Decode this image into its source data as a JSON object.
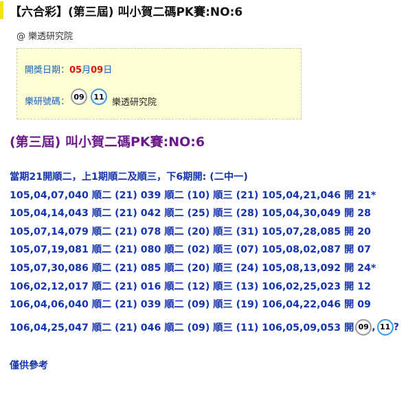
{
  "header": {
    "title": "【六合彩】(第三屆) 叫小賀二碼PK賽:NO:6",
    "source": "@ 樂透研究院"
  },
  "info_box": {
    "draw_date_label": "開獎日期：",
    "draw_month": "05",
    "month_unit": "月",
    "draw_day": "09",
    "day_unit": "日",
    "numbers_label": "樂研號碼：",
    "balls": [
      "09",
      "11"
    ],
    "source_name": "樂透研究院"
  },
  "main": {
    "heading": "(第三屆) 叫小賀二碼PK賽:NO:6",
    "intro": "當期21開順二，上1期順二及順三，下6期開: (二中一)",
    "records": [
      "105,04,07,040 順二 (21) 039 順二 (10) 順三 (21) 105,04,21,046 開 21*",
      "105,04,14,043 順二 (21) 042 順二 (25) 順三 (28) 105,04,30,049 開 28",
      "105,07,14,079 順二 (21) 078 順二 (20) 順三 (31) 105,07,28,085 開 20",
      "105,07,19,081 順二 (21) 080 順二 (02) 順三 (07) 105,08,02,087 開 07",
      "105,07,30,086 順二 (21) 085 順二 (20) 順三 (24) 105,08,13,092 開 24*",
      "106,02,12,017 順二 (21) 016 順二 (12) 順三 (13) 106,02,25,023 開 12",
      "106,04,06,040 順二 (21) 039 順二 (09) 順三 (19) 106,04,22,046 開 09"
    ],
    "last_record_prefix": "106,04,25,047 順二 (21) 046 順二 (09) 順三 (11) 106,05,09,053 開",
    "last_balls": [
      "09",
      "11"
    ],
    "last_separator": ",",
    "last_suffix": "?",
    "footer": "僅供參考"
  },
  "colors": {
    "accent_bar": "#f5e10a",
    "heading": "#6a1a8a",
    "record_text": "#1434b0",
    "date_highlight": "#e01010",
    "info_box_bg": "#ffffd4"
  }
}
